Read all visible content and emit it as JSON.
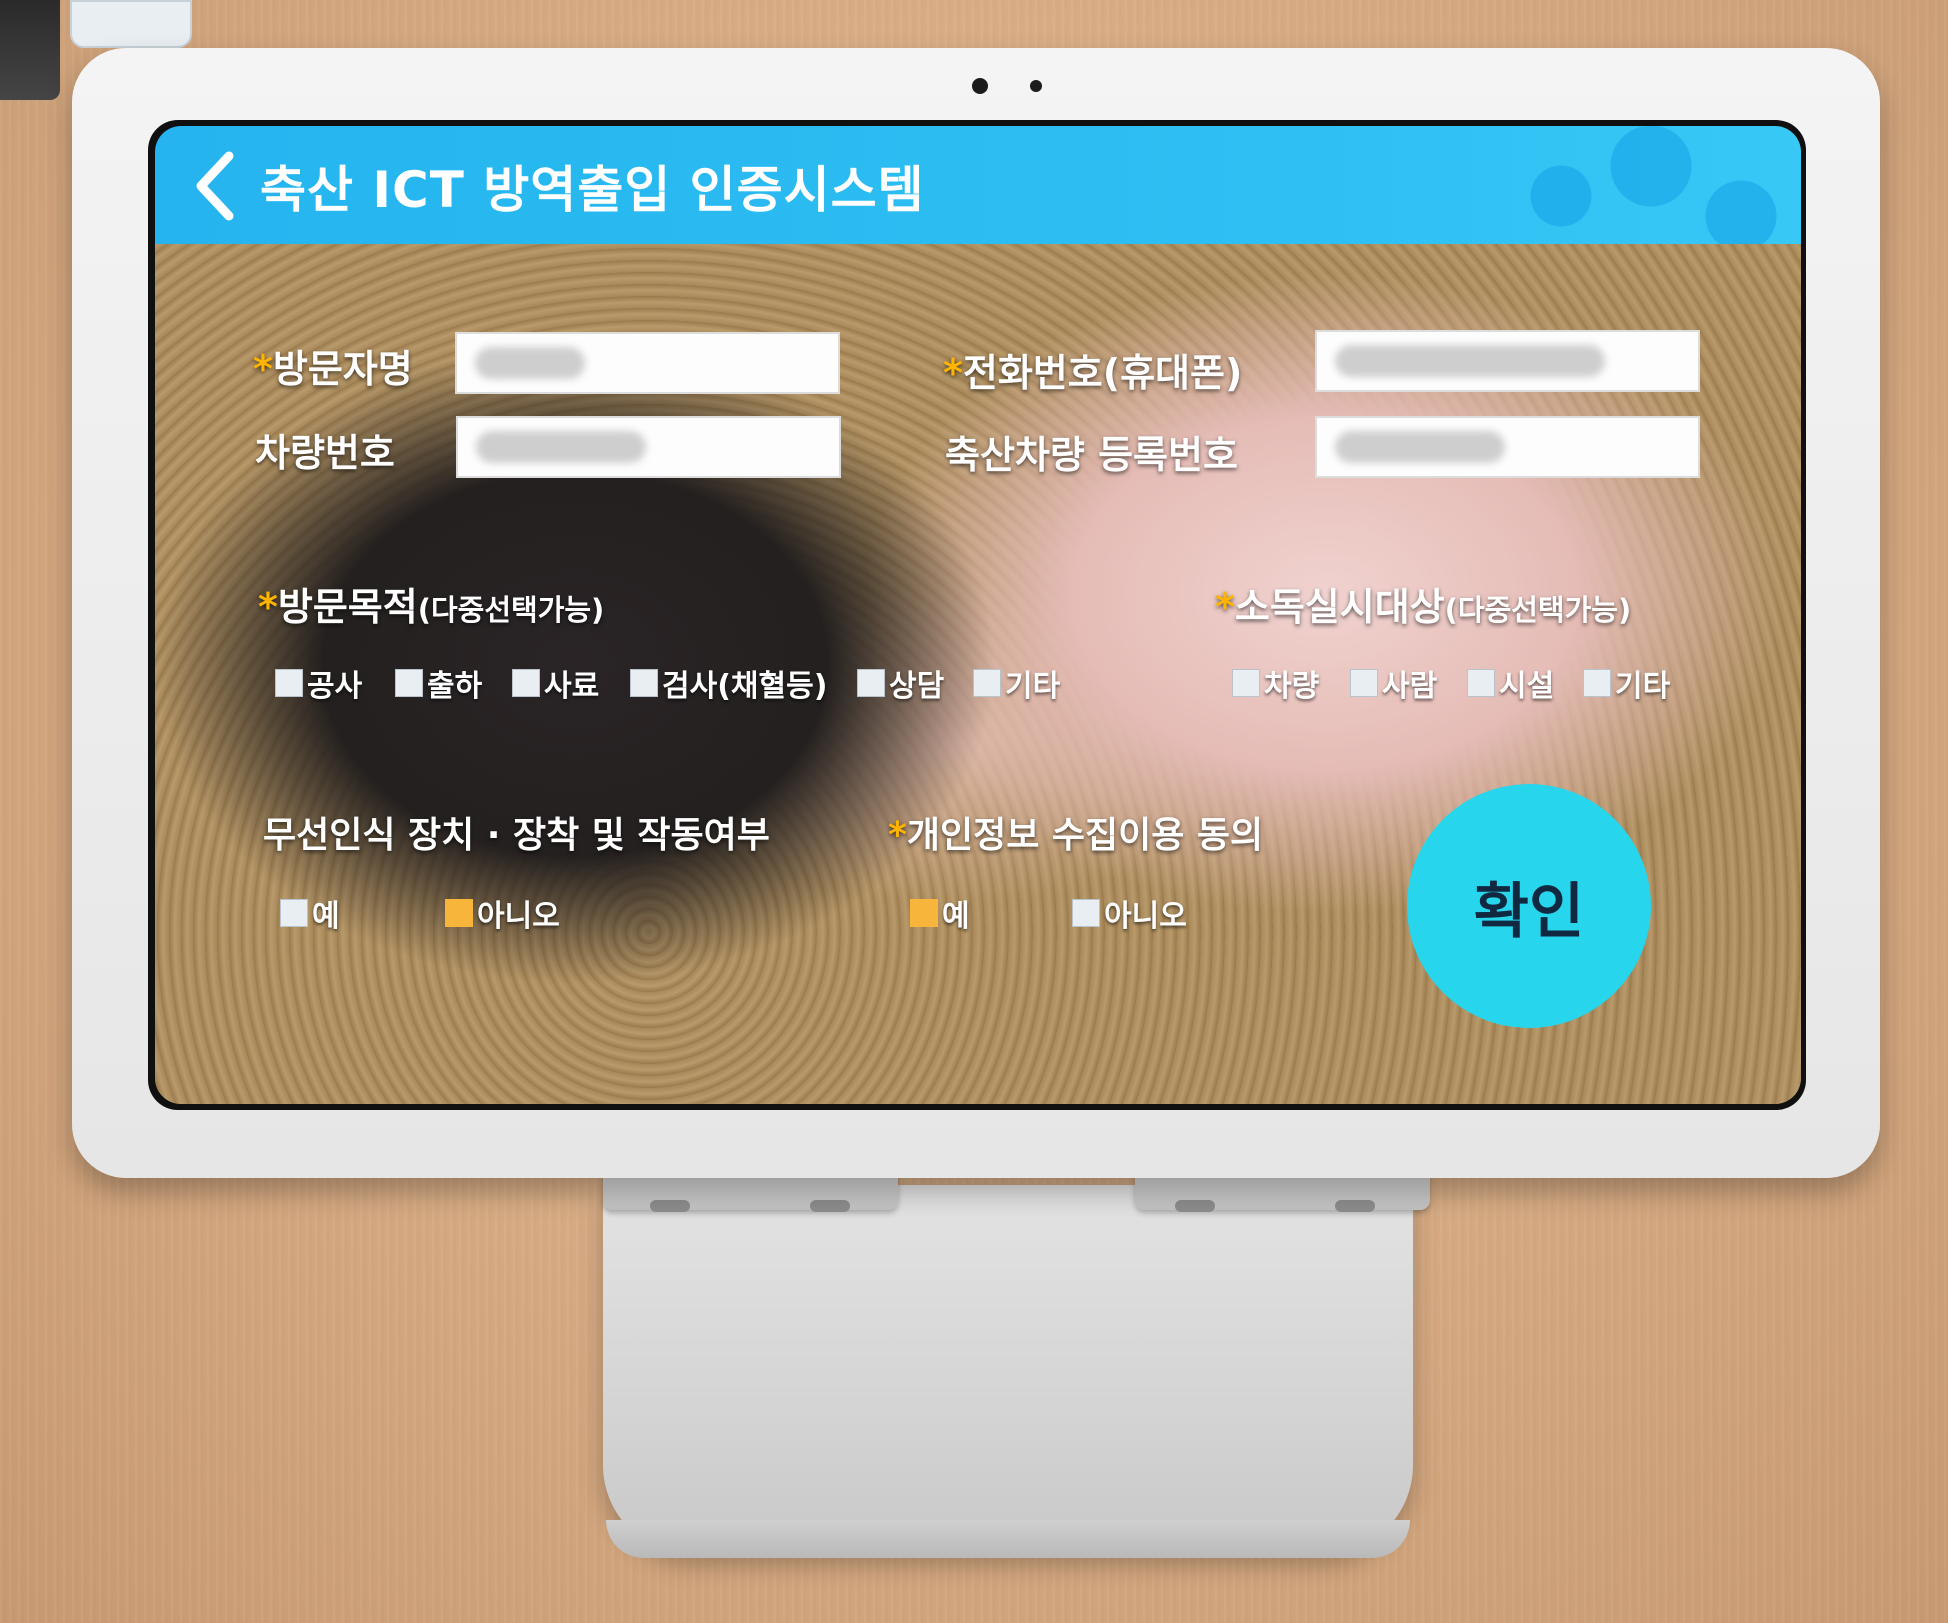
{
  "header": {
    "title": "축산 ICT 방역출입 인증시스템"
  },
  "form": {
    "visitor_name_label": "방문자명",
    "phone_label": "전화번호(휴대폰)",
    "vehicle_no_label": "차량번호",
    "livestock_vehicle_label": "축산차량 등록번호",
    "required_mark": "*"
  },
  "visit_purpose": {
    "label": "방문목적",
    "note": "(다중선택가능)",
    "options": [
      {
        "label": "공사",
        "checked": false
      },
      {
        "label": "출하",
        "checked": false
      },
      {
        "label": "사료",
        "checked": false
      },
      {
        "label": "검사(채혈등)",
        "checked": false
      },
      {
        "label": "상담",
        "checked": false
      },
      {
        "label": "기타",
        "checked": false
      }
    ]
  },
  "disinfection": {
    "label": "소독실시대상",
    "note": "(다중선택가능)",
    "options": [
      {
        "label": "차량",
        "checked": false
      },
      {
        "label": "사람",
        "checked": false
      },
      {
        "label": "시설",
        "checked": false
      },
      {
        "label": "기타",
        "checked": false
      }
    ]
  },
  "wireless": {
    "label": "무선인식 장치 · 장착 및 작동여부",
    "options": [
      {
        "label": "예",
        "checked": false
      },
      {
        "label": "아니오",
        "checked": true
      }
    ]
  },
  "privacy": {
    "label": "개인정보 수집이용 동의",
    "options": [
      {
        "label": "예",
        "checked": true
      },
      {
        "label": "아니오",
        "checked": false
      }
    ]
  },
  "confirm_label": "확인",
  "colors": {
    "header": "#2ec0f3",
    "confirm": "#27d5ec",
    "required": "#ffb400",
    "checked": "#f7b53c"
  }
}
